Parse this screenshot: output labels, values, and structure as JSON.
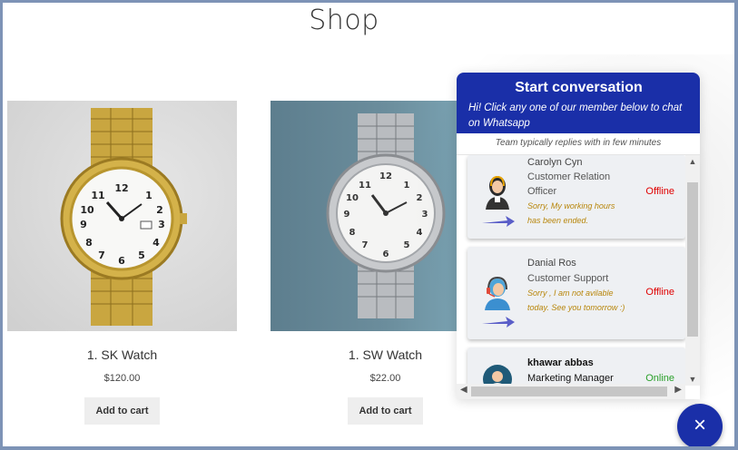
{
  "page": {
    "title": "Shop"
  },
  "products": [
    {
      "name": "1. SK Watch",
      "price": "$120.00",
      "button": "Add to cart"
    },
    {
      "name": "1. SW Watch",
      "price": "$22.00",
      "button": "Add to cart"
    }
  ],
  "chat": {
    "title": "Start conversation",
    "subtitle": "Hi! Click any one of our member below to chat on Whatsapp",
    "note": "Team typically replies with in few minutes",
    "members": [
      {
        "name": "Carolyn Cyn",
        "role": "Customer Relation Officer",
        "message": "Sorry, My working hours has been ended.",
        "status": "Offline",
        "status_color": "#e00000"
      },
      {
        "name": "Danial Ros",
        "role": "Customer Support",
        "message": "Sorry , I am not avilable today. See you tomorrow :)",
        "status": "Offline",
        "status_color": "#e00000"
      },
      {
        "name": "khawar abbas",
        "role": "Marketing Manager",
        "message": "",
        "status": "Online",
        "status_color": "#2aa02a"
      }
    ],
    "close_icon": "×"
  },
  "colors": {
    "brand": "#1a2fa8",
    "offline": "#e00000",
    "online": "#2aa02a"
  }
}
